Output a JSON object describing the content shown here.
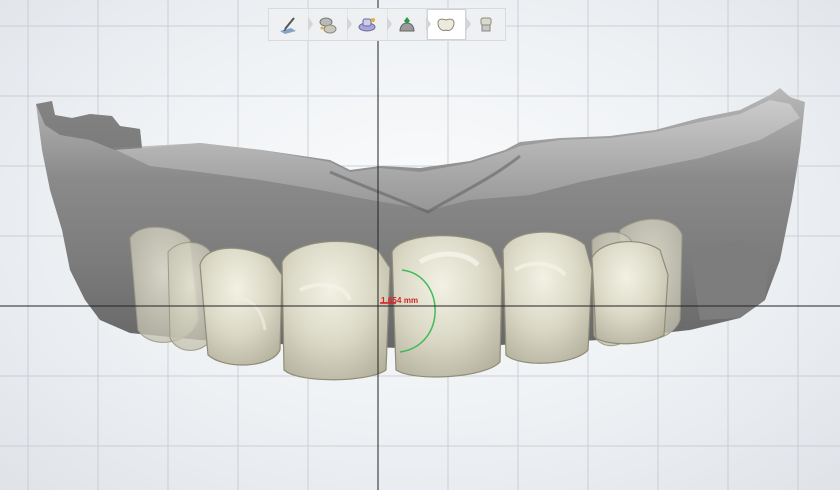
{
  "toolbar": {
    "tools": [
      {
        "name": "pencil-design-icon"
      },
      {
        "name": "margin-tool-icon"
      },
      {
        "name": "insertion-axis-icon"
      },
      {
        "name": "anatomy-icon"
      },
      {
        "name": "crown-tooth-icon",
        "active": true
      },
      {
        "name": "abutment-icon"
      }
    ]
  },
  "measurement": {
    "value": "1.654 mm",
    "color": "#d42424",
    "arc_color": "#2db84a"
  },
  "colors": {
    "gingiva_model": "#8e8e8e",
    "tooth": "#d8d6c4",
    "crosshair": "#222222",
    "grid": "#c4c9cf"
  }
}
